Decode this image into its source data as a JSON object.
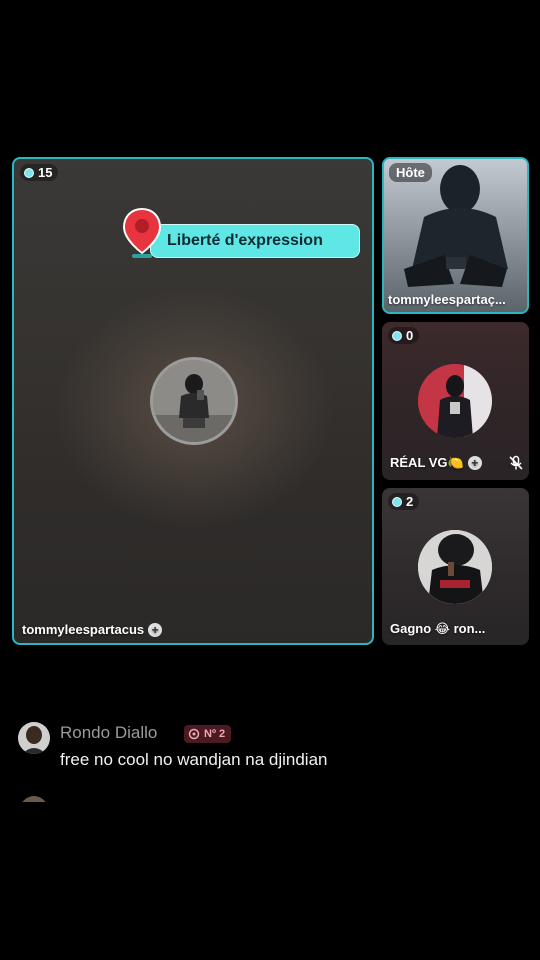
{
  "main": {
    "viewers": "15",
    "topic": "Liberté d'expression",
    "name": "tommyleespartacus"
  },
  "host_tile": {
    "badge": "Hôte",
    "name": "tommyleespartaç..."
  },
  "guest1": {
    "viewers": "0",
    "name": "RÉAL VG🍋"
  },
  "guest2": {
    "viewers": "2",
    "name": "Gagno 😂 ron..."
  },
  "comments": [
    {
      "username": "Rondo Diallo",
      "badge": "Nº 2",
      "text": "free no cool no wandjan na djindian"
    }
  ],
  "colors": {
    "accent": "#2bb7c2",
    "topic_bg": "#5ee7e4"
  }
}
